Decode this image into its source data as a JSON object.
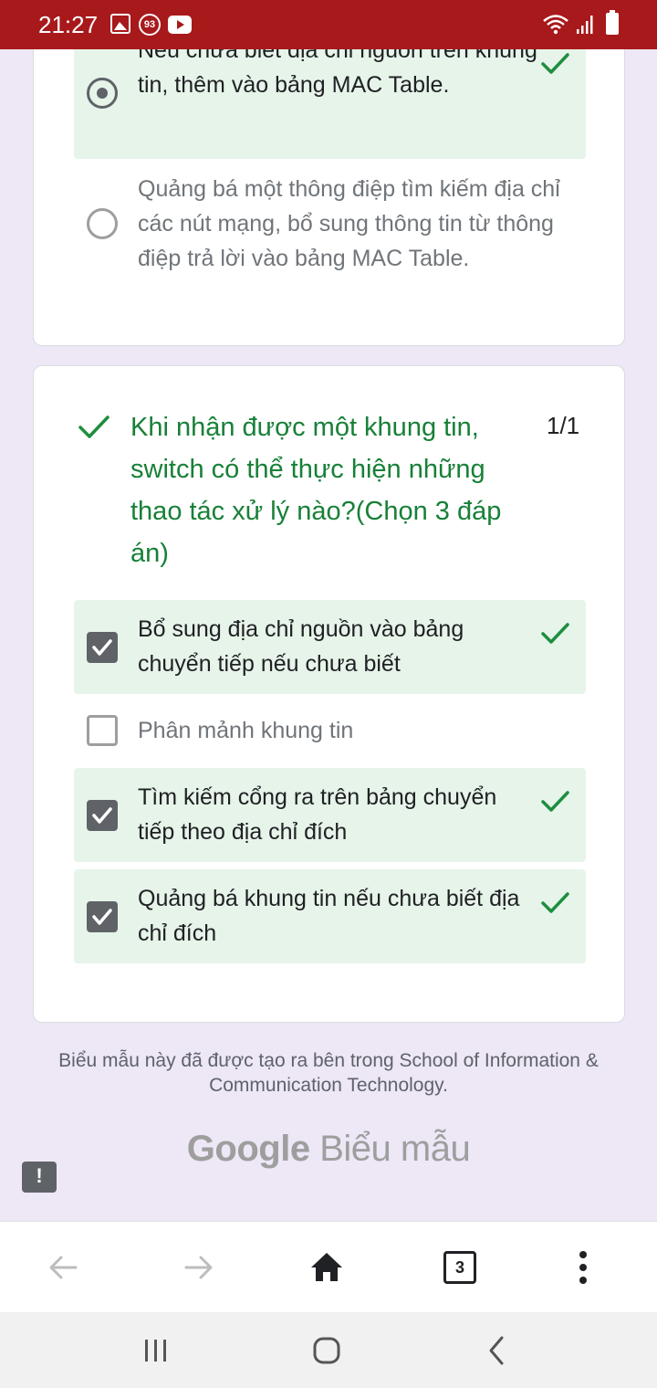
{
  "status_bar": {
    "time": "21:27",
    "badge": "93",
    "icons": [
      "image-icon",
      "badge-icon",
      "youtube-icon",
      "wifi-icon",
      "signal-icon",
      "battery-icon"
    ]
  },
  "question_prev": {
    "options": [
      {
        "text": "Nếu chưa biết địa chỉ nguồn trên khung tin, thêm vào bảng MAC Table.",
        "selected": true,
        "correct": true
      },
      {
        "text": "Quảng bá một thông điệp tìm kiếm địa chỉ các nút mạng, bổ sung thông tin từ thông điệp trả lời vào bảng MAC Table.",
        "selected": false,
        "correct": false
      }
    ]
  },
  "question": {
    "title": "Khi nhận được một khung tin, switch có thể thực hiện những thao tác xử lý nào?(Chọn 3 đáp án)",
    "score": "1/1",
    "options": [
      {
        "text": "Bổ sung địa chỉ nguồn vào bảng chuyển tiếp nếu chưa biết",
        "checked": true,
        "correct": true
      },
      {
        "text": "Phân mảnh khung tin",
        "checked": false,
        "correct": false
      },
      {
        "text": "Tìm kiếm cổng ra trên bảng chuyển tiếp theo địa chỉ đích",
        "checked": true,
        "correct": true
      },
      {
        "text": "Quảng bá khung tin nếu chưa biết địa chỉ đích",
        "checked": true,
        "correct": true
      }
    ]
  },
  "footer": {
    "note": "Biểu mẫu này đã được tạo ra bên trong School of Information & Communication Technology.",
    "brand_google": "Google",
    "brand_forms": "Biểu mẫu",
    "report_label": "!"
  },
  "browser_toolbar": {
    "tab_count": "3",
    "buttons": [
      "back-icon",
      "forward-icon",
      "home-icon",
      "tabs-button",
      "more-icon"
    ]
  },
  "colors": {
    "status_bar": "#a8191c",
    "background": "#ede7f6",
    "correct_fill": "#e6f4ea",
    "correct_text": "#188038",
    "tick": "#1e8e3e"
  }
}
